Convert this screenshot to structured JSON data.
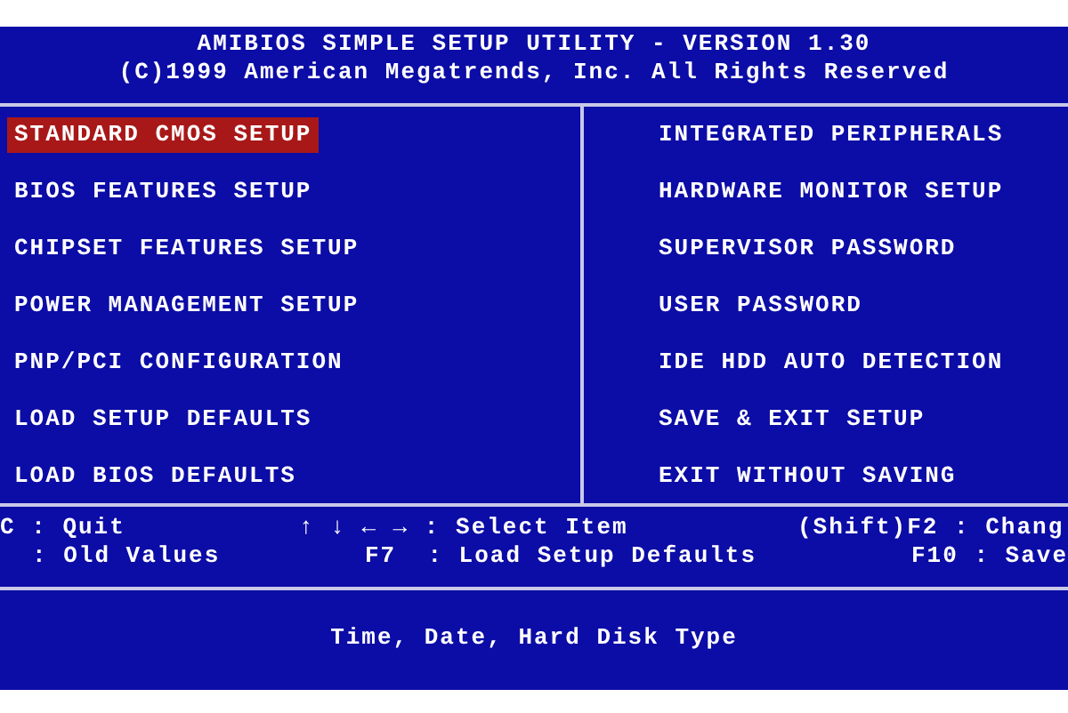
{
  "header": {
    "title": "AMIBIOS SIMPLE SETUP UTILITY - VERSION 1.30",
    "copyright": "(C)1999 American Megatrends, Inc. All Rights Reserved"
  },
  "menu_columns": [
    [
      {
        "label": "STANDARD CMOS SETUP",
        "selected": true
      },
      {
        "label": "BIOS FEATURES SETUP",
        "selected": false
      },
      {
        "label": "CHIPSET FEATURES SETUP",
        "selected": false
      },
      {
        "label": "POWER MANAGEMENT SETUP",
        "selected": false
      },
      {
        "label": "PNP/PCI CONFIGURATION",
        "selected": false
      },
      {
        "label": "LOAD SETUP DEFAULTS",
        "selected": false
      },
      {
        "label": "LOAD BIOS DEFAULTS",
        "selected": false
      }
    ],
    [
      {
        "label": "INTEGRATED PERIPHERALS",
        "selected": false
      },
      {
        "label": "HARDWARE MONITOR SETUP",
        "selected": false
      },
      {
        "label": "SUPERVISOR PASSWORD",
        "selected": false
      },
      {
        "label": "USER PASSWORD",
        "selected": false
      },
      {
        "label": "IDE HDD AUTO DETECTION",
        "selected": false
      },
      {
        "label": "SAVE & EXIT SETUP",
        "selected": false
      },
      {
        "label": "EXIT WITHOUT SAVING",
        "selected": false
      }
    ]
  ],
  "key_help": [
    [
      "C : Quit",
      "↑ ↓ ← → : Select Item",
      "(Shift)F2 : Chang"
    ],
    [
      ": Old Values",
      "F7  : Load Setup Defaults",
      "F10 : Save"
    ]
  ],
  "description": "Time, Date, Hard Disk Type"
}
